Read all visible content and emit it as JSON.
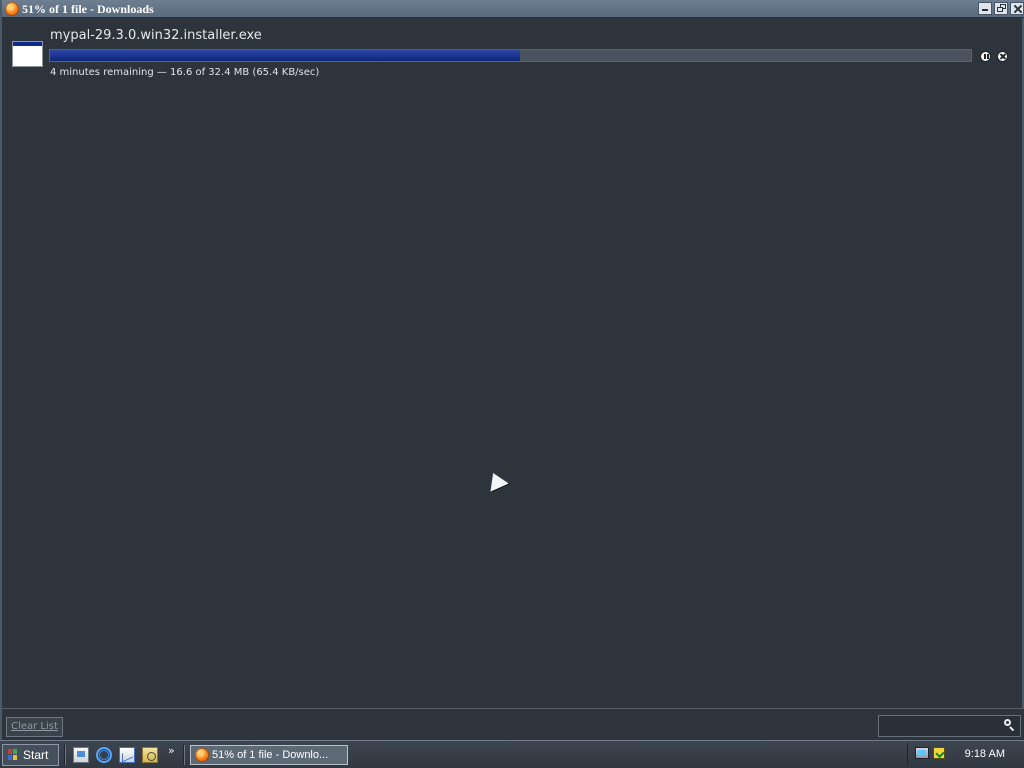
{
  "window": {
    "title": "51% of 1 file - Downloads"
  },
  "download": {
    "file_name": "mypal-29.3.0.win32.installer.exe",
    "progress": 0.51,
    "status": "4 minutes remaining — 16.6 of 32.4 MB (65.4 KB/sec)"
  },
  "footer": {
    "clear_list_label": "Clear List",
    "search_value": ""
  },
  "taskbar": {
    "start_label": "Start",
    "overflow_label": "»",
    "active_task_label": "51% of 1 file - Downlo...",
    "clock": "9:18 AM"
  },
  "icons": {
    "title": "firefox-icon",
    "download_file": "application-file-icon",
    "pause": "pause-icon",
    "cancel": "cancel-icon",
    "search": "search-icon",
    "desktop": "desktop-icon",
    "browser": "internet-explorer-icon",
    "mail": "mail-icon",
    "explorer": "folder-search-icon",
    "tray_network": "network-icon",
    "tray_status": "security-icon"
  },
  "colors": {
    "window_bg": "#2e343b",
    "progress_fill": "#10267a",
    "taskbar_bg": "#313842"
  }
}
